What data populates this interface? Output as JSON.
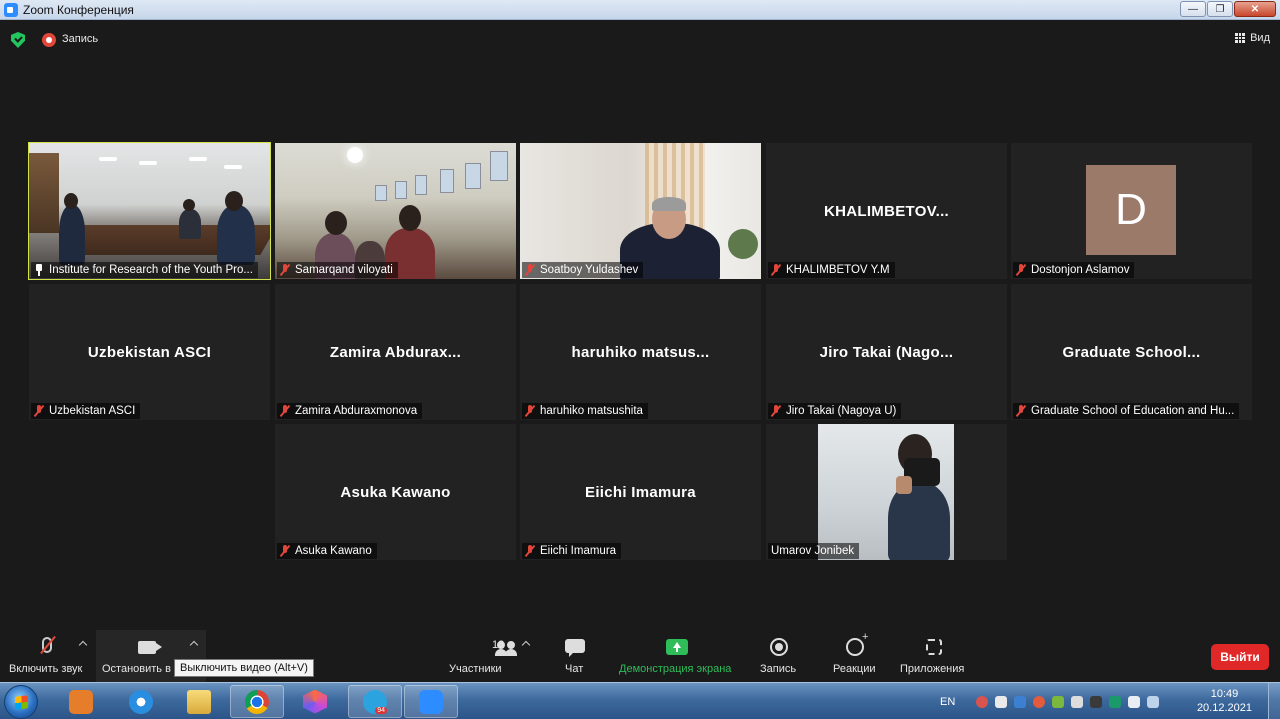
{
  "window": {
    "title": "Zoom Конференция",
    "buttons": {
      "minimize": "—",
      "maximize": "❐",
      "close": "✕"
    }
  },
  "topbar": {
    "recording_label": "Запись",
    "view_label": "Вид"
  },
  "tiles": [
    {
      "id": "institute",
      "label": "Institute for Research of the Youth Pro...",
      "status_icon": "pin-icon",
      "video": "classroom",
      "active": true
    },
    {
      "id": "samarqand",
      "label": "Samarqand viloyati",
      "status_icon": "mute-icon",
      "video": "samarqand"
    },
    {
      "id": "soatboy",
      "label": "Soatboy Yuldashev",
      "status_icon": "mute-icon",
      "video": "soatboy"
    },
    {
      "id": "khalimbetov",
      "center_name": "KHALIMBETOV...",
      "label": "KHALIMBETOV  Y.M",
      "status_icon": "mute-icon"
    },
    {
      "id": "dostonjon",
      "avatar_letter": "D",
      "avatar_color": "#9c7a6a",
      "label": "Dostonjon Aslamov",
      "status_icon": "mute-icon"
    },
    {
      "id": "uzbekistan",
      "center_name": "Uzbekistan ASCI",
      "label": "Uzbekistan ASCI",
      "status_icon": "mute-icon"
    },
    {
      "id": "zamira",
      "center_name": "Zamira  Abdurax...",
      "label": "Zamira Abduraxmonova",
      "status_icon": "mute-icon"
    },
    {
      "id": "haruhiko",
      "center_name": "haruhiko  matsus...",
      "label": "haruhiko matsushita",
      "status_icon": "mute-icon"
    },
    {
      "id": "jiro",
      "center_name": "Jiro  Takai  (Nago...",
      "label": "Jiro Takai (Nagoya U)",
      "status_icon": "mute-icon"
    },
    {
      "id": "graduate",
      "center_name": "Graduate  School...",
      "label": "Graduate School of Education and Hu...",
      "status_icon": "mute-icon"
    },
    {
      "id": "asuka",
      "center_name": "Asuka Kawano",
      "label": "Asuka Kawano",
      "status_icon": "mute-icon"
    },
    {
      "id": "eiichi",
      "center_name": "Eiichi Imamura",
      "label": "Eiichi Imamura",
      "status_icon": "mute-icon"
    },
    {
      "id": "umarov",
      "label": "Umarov Jonibek",
      "status_icon": "none",
      "video": "umarov"
    }
  ],
  "toolbar": {
    "unmute_label": "Включить звук",
    "stop_video_label": "Остановить в",
    "participants_label": "Участники",
    "participants_count": "13",
    "chat_label": "Чат",
    "share_label": "Демонстрация экрана",
    "record_label": "Запись",
    "reactions_label": "Реакции",
    "apps_label": "Приложения",
    "leave_label": "Выйти",
    "tooltip": "Выключить видео (Alt+V)",
    "share_color": "#2ebd59",
    "leave_color": "#e02828"
  },
  "taskbar": {
    "apps": [
      "media-player-icon",
      "internet-explorer-icon",
      "file-explorer-icon",
      "chrome-icon",
      "office-icon",
      "telegram-icon",
      "zoom-icon"
    ],
    "telegram_badge": "94",
    "lang": "EN",
    "time": "10:49",
    "date": "20.12.2021"
  }
}
